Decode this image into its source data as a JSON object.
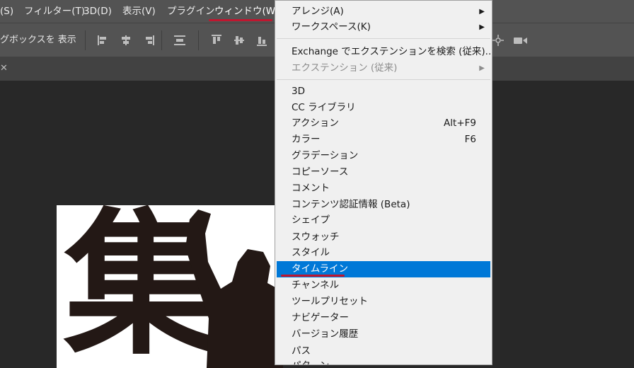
{
  "menubar": {
    "items": [
      {
        "label": "(S)"
      },
      {
        "label": "フィルター(T)"
      },
      {
        "label": "3D(D)"
      },
      {
        "label": "表示(V)"
      },
      {
        "label": "プラグイン"
      },
      {
        "label": "ウィンドウ(W)"
      }
    ]
  },
  "options": {
    "show_label": "グボックスを 表示"
  },
  "tabs": {
    "close_glyph": "✕"
  },
  "canvas": {
    "kanji": "集"
  },
  "window_menu": {
    "items": [
      {
        "label": "アレンジ(A)",
        "shortcut": "",
        "submenu": true,
        "disabled": false
      },
      {
        "label": "ワークスペース(K)",
        "shortcut": "",
        "submenu": true,
        "disabled": false
      },
      {
        "label": "Exchange でエクステンションを検索 (従来)...",
        "shortcut": "",
        "submenu": false,
        "disabled": false
      },
      {
        "label": "エクステンション (従来)",
        "shortcut": "",
        "submenu": true,
        "disabled": true
      },
      {
        "label": "3D",
        "shortcut": ""
      },
      {
        "label": "CC ライブラリ",
        "shortcut": ""
      },
      {
        "label": "アクション",
        "shortcut": "Alt+F9"
      },
      {
        "label": "カラー",
        "shortcut": "F6"
      },
      {
        "label": "グラデーション",
        "shortcut": ""
      },
      {
        "label": "コピーソース",
        "shortcut": ""
      },
      {
        "label": "コメント",
        "shortcut": ""
      },
      {
        "label": "コンテンツ認証情報 (Beta)",
        "shortcut": ""
      },
      {
        "label": "シェイプ",
        "shortcut": ""
      },
      {
        "label": "スウォッチ",
        "shortcut": ""
      },
      {
        "label": "スタイル",
        "shortcut": ""
      },
      {
        "label": "タイムライン",
        "shortcut": "",
        "highlighted": true
      },
      {
        "label": "チャンネル",
        "shortcut": ""
      },
      {
        "label": "ツールプリセット",
        "shortcut": ""
      },
      {
        "label": "ナビゲーター",
        "shortcut": ""
      },
      {
        "label": "バージョン履歴",
        "shortcut": ""
      },
      {
        "label": "パス",
        "shortcut": ""
      },
      {
        "label": "パターン",
        "shortcut": ""
      }
    ],
    "submenu_arrow": "▶"
  },
  "colors": {
    "highlight": "#0078d7",
    "annotation_underline": "#c0162f",
    "menubar_bg": "#535353",
    "canvas_bg": "#282828"
  }
}
